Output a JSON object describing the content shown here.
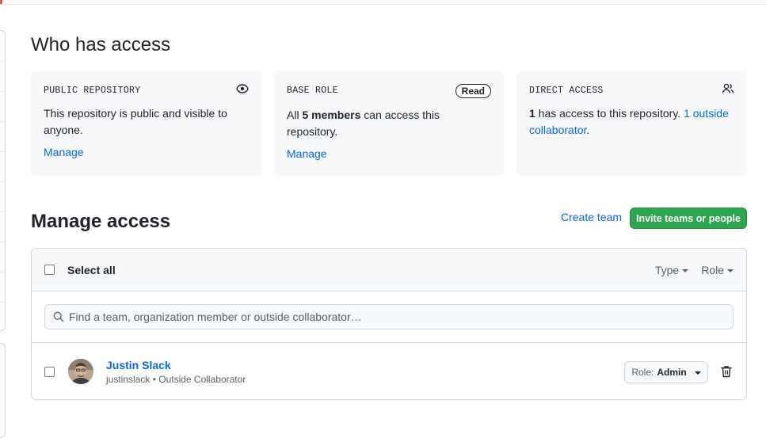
{
  "page": {
    "access_title": "Who has access",
    "manage_title": "Manage access"
  },
  "cards": [
    {
      "title": "PUBLIC REPOSITORY",
      "icon": "eye-icon",
      "body": "This repository is public and visible to anyone.",
      "manage_label": "Manage"
    },
    {
      "title": "BASE ROLE",
      "badge": "Read",
      "body_prefix": "All ",
      "body_strong": "5 members",
      "body_suffix": " can access this repository.",
      "manage_label": "Manage"
    },
    {
      "title": "DIRECT ACCESS",
      "icon": "people-icon",
      "body_strong": "1",
      "body_mid": " has access to this repository. ",
      "body_link": "1 outside collaborator",
      "body_end": "."
    }
  ],
  "actions": {
    "create_team": "Create team",
    "invite": "Invite teams or people"
  },
  "table": {
    "select_all": "Select all",
    "filters": [
      {
        "label": "Type"
      },
      {
        "label": "Role"
      }
    ],
    "search_placeholder": "Find a team, organization member or outside collaborator…",
    "members": [
      {
        "name": "Justin Slack",
        "username": "justinslack",
        "relation": "Outside Collaborator",
        "role_prefix": "Role: ",
        "role": "Admin"
      }
    ]
  },
  "colors": {
    "accent_link": "#0969da",
    "invite_green": "#2da44e"
  }
}
